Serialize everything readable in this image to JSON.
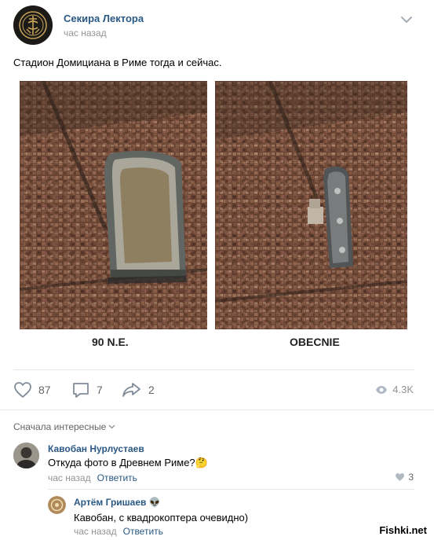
{
  "post": {
    "author": "Секира Лектора",
    "time": "час назад",
    "text": "Стадион Домициана в Риме тогда и сейчас.",
    "images": [
      {
        "caption": "90 N.E."
      },
      {
        "caption": "OBECNIE"
      }
    ],
    "likes": "87",
    "comments": "7",
    "shares": "2",
    "views": "4.3K"
  },
  "comments_header": {
    "sort_label": "Сначала интересные"
  },
  "comments": [
    {
      "author": "Кавобан Нурлустаев",
      "text": "Откуда фото в Древнем Риме?🤔",
      "time": "час назад",
      "reply_label": "Ответить",
      "likes": "3"
    },
    {
      "author": "Артём Гришаев 👽",
      "text": "Кавобан, с квадрокоптера очевидно)",
      "time": "час назад",
      "reply_label": "Ответить"
    }
  ],
  "watermark": "Fishki.net",
  "colors": {
    "link": "#2a5885",
    "meta": "#939393",
    "separator": "#e7e8ec"
  }
}
